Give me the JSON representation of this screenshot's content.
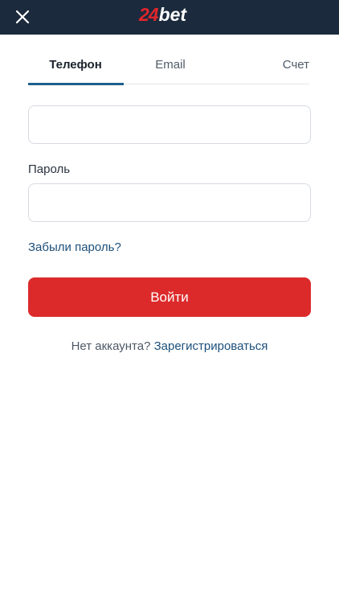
{
  "header": {
    "logo_number": "24",
    "logo_word": "bet",
    "close_icon": "close-icon"
  },
  "tabs": [
    {
      "label": "Телефон",
      "active": true
    },
    {
      "label": "Email",
      "active": false
    },
    {
      "label": "Счет",
      "active": false
    }
  ],
  "form": {
    "phone_value": "",
    "password_label": "Пароль",
    "password_value": "",
    "forgot_link": "Забыли пароль?",
    "submit_label": "Войти"
  },
  "footer": {
    "no_account_text": "Нет аккаунта?",
    "register_link": "Зарегистрироваться"
  },
  "colors": {
    "header_bg": "#1b2a3d",
    "brand_red": "#dc2a2b",
    "link_blue": "#1d4f7a",
    "tab_underline": "#1f5f8f"
  }
}
